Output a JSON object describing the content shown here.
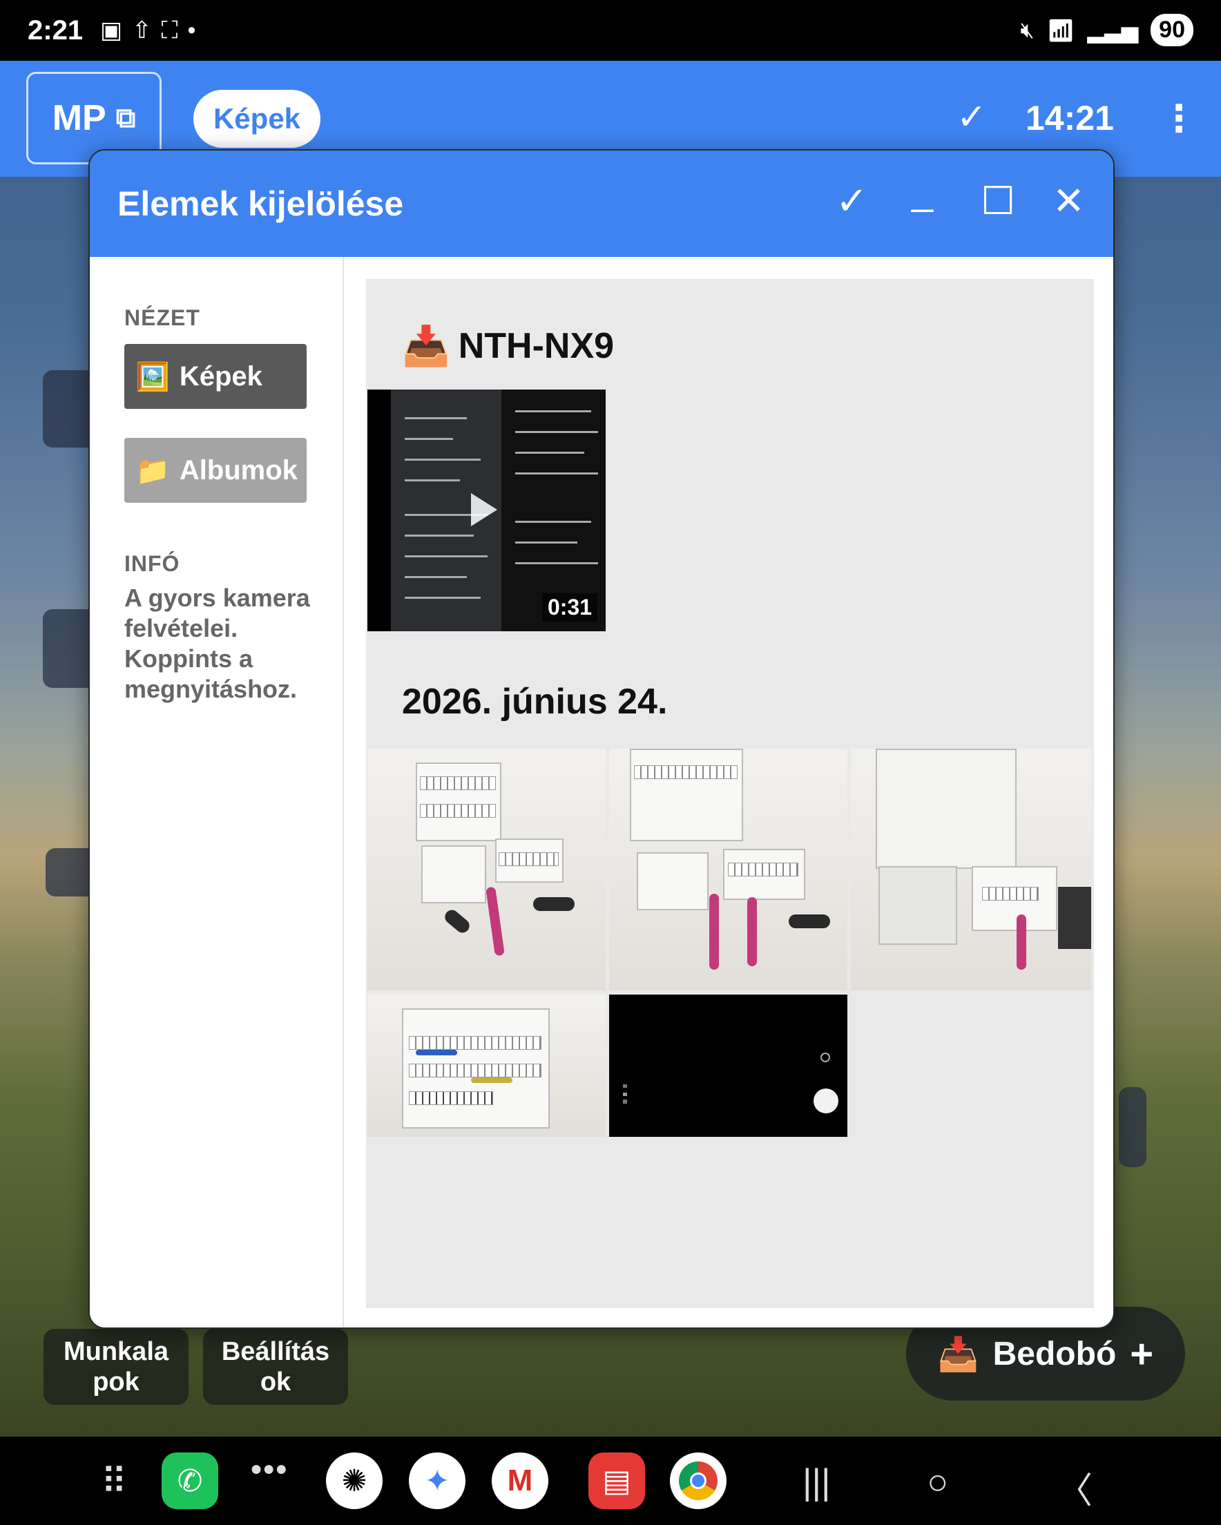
{
  "status_bar": {
    "time": "2:21",
    "left_icons": [
      "sim-icon",
      "upload-icon",
      "screenshot-icon",
      "dot-icon"
    ],
    "right_icons": [
      "mute-icon",
      "wifi-icon",
      "signal-icon"
    ],
    "battery": "90"
  },
  "top_bar": {
    "mp_label": "MP",
    "kepek_label": "Képek",
    "clock": "14:21"
  },
  "dialog": {
    "title": "Elemek kijelölése",
    "sidebar": {
      "view_heading": "NÉZET",
      "view_items": [
        {
          "emoji": "🖼️",
          "label": "Képek",
          "active": true
        },
        {
          "emoji": "📁",
          "label": "Albumok",
          "active": false
        }
      ],
      "info_heading": "INFÓ",
      "info_text": "A gyors kamera felvételei. Koppints a megnyitáshoz."
    },
    "sections": [
      {
        "title": "NTH-NX9",
        "icon": "📥",
        "items": [
          {
            "type": "video",
            "duration": "0:31"
          }
        ]
      },
      {
        "title": "2026. június 24.",
        "items": [
          {
            "type": "photo"
          },
          {
            "type": "photo"
          },
          {
            "type": "photo"
          },
          {
            "type": "photo"
          },
          {
            "type": "photo"
          }
        ]
      }
    ]
  },
  "launcher": {
    "buttons": [
      "Munkala pok",
      "Beállítás ok"
    ],
    "bedobo_label": "Bedobó",
    "bedobo_icon": "📥"
  },
  "dock_apps": [
    "apps-grid-icon",
    "phone-icon",
    "messenger-cluster-icon",
    "chatgpt-icon",
    "gemini-icon",
    "gmail-icon",
    "notes-icon",
    "chrome-icon"
  ],
  "colors": {
    "accent": "#3f83f0",
    "active_nav": "#595959",
    "inactive_nav": "#a4a4a4"
  }
}
